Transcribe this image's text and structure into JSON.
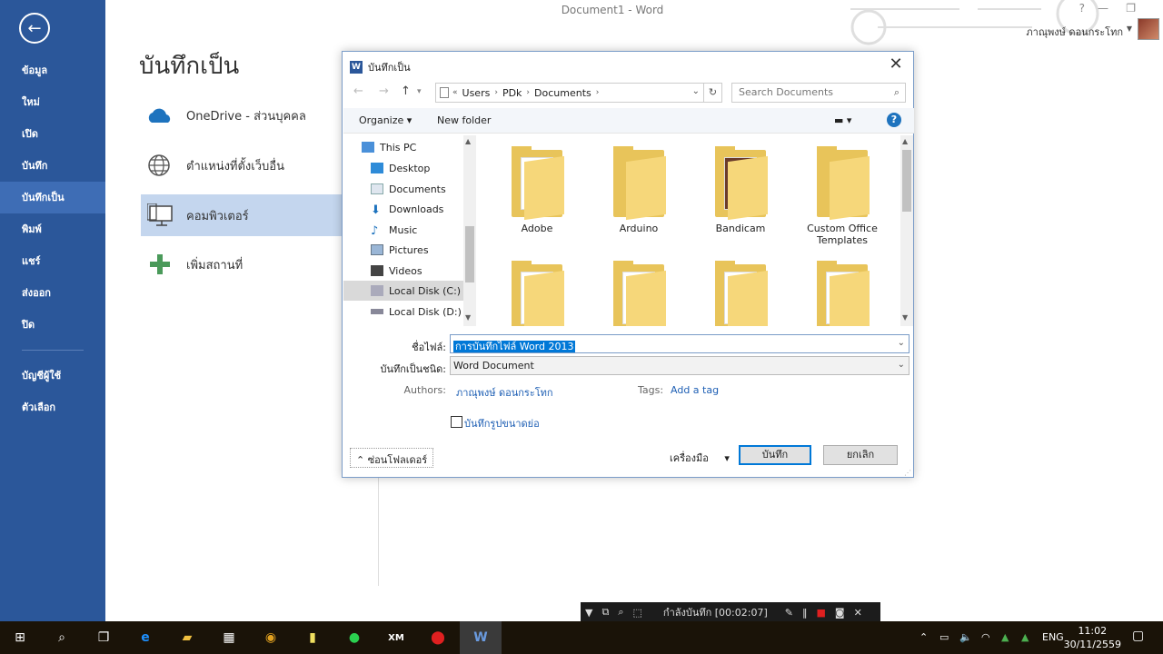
{
  "window": {
    "title": "Document1 - Word",
    "user_name": "ภาณุพงษ์ ดอนกระโทก"
  },
  "sidebar": {
    "items": [
      {
        "label": "ข้อมูล"
      },
      {
        "label": "ใหม่"
      },
      {
        "label": "เปิด"
      },
      {
        "label": "บันทึก"
      },
      {
        "label": "บันทึกเป็น"
      },
      {
        "label": "พิมพ์"
      },
      {
        "label": "แชร์"
      },
      {
        "label": "ส่งออก"
      },
      {
        "label": "ปิด"
      },
      {
        "label": "บัญชีผู้ใช้"
      },
      {
        "label": "ตัวเลือก"
      }
    ]
  },
  "backstage": {
    "title": "บันทึกเป็น",
    "places": [
      {
        "label": "OneDrive - ส่วนบุคคล",
        "icon": "cloud-icon"
      },
      {
        "label": "ตำแหน่งที่ตั้งเว็บอื่น",
        "icon": "globe-icon"
      },
      {
        "label": "คอมพิวเตอร์",
        "icon": "computer-icon"
      },
      {
        "label": "เพิ่มสถานที่",
        "icon": "plus-icon"
      }
    ]
  },
  "dialog": {
    "title": "บันทึกเป็น",
    "breadcrumb": [
      "Users",
      "PDk",
      "Documents"
    ],
    "breadcrumb_prefix": "«",
    "search_placeholder": "Search Documents",
    "organize": "Organize",
    "new_folder": "New folder",
    "nav": [
      {
        "label": "This PC"
      },
      {
        "label": "Desktop"
      },
      {
        "label": "Documents"
      },
      {
        "label": "Downloads"
      },
      {
        "label": "Music"
      },
      {
        "label": "Pictures"
      },
      {
        "label": "Videos"
      },
      {
        "label": "Local Disk (C:)"
      },
      {
        "label": "Local Disk (D:)"
      }
    ],
    "folders": [
      {
        "name": "Adobe"
      },
      {
        "name": "Arduino"
      },
      {
        "name": "Bandicam"
      },
      {
        "name": "Custom Office Templates"
      },
      {
        "name": ""
      },
      {
        "name": ""
      },
      {
        "name": ""
      },
      {
        "name": ""
      }
    ],
    "filename_label": "ชื่อไฟล์:",
    "filename_value": "การบันทึกไฟล์ Word 2013",
    "type_label": "บันทึกเป็นชนิด:",
    "type_value": "Word Document",
    "authors_label": "Authors:",
    "authors_value": "ภาณุพงษ์ ดอนกระโทก",
    "tags_label": "Tags:",
    "tags_value": "Add a tag",
    "thumbnail_label": "บันทึกรูปขนาดย่อ",
    "hide_folders": "ซ่อนโฟลเดอร์",
    "tools": "เครื่องมือ",
    "save": "บันทึก",
    "cancel": "ยกเลิก"
  },
  "recording": {
    "status": "กำลังบันทึก [00:02:07]"
  },
  "taskbar": {
    "language": "ENG",
    "time": "11:02",
    "date": "30/11/2559"
  }
}
